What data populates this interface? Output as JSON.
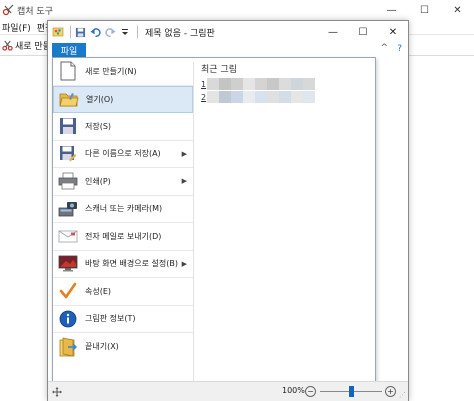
{
  "snipping_tool": {
    "title": "캡처 도구",
    "menu": [
      "파일(F)",
      "편집(E)"
    ],
    "new_button": "새로 만들기",
    "window_controls": {
      "minimize": "—",
      "maximize": "☐",
      "close": "✕"
    }
  },
  "paint": {
    "title": "제목 없음 - 그림판",
    "window_controls": {
      "minimize": "—",
      "maximize": "☐",
      "close": "✕"
    },
    "file_tab": "파일",
    "help": "?",
    "ribbon_minimize": "^",
    "qat_icons": [
      "paint-app-icon",
      "save-icon",
      "undo-icon",
      "redo-icon",
      "customize-dropdown-icon"
    ]
  },
  "file_menu": {
    "items": [
      {
        "label": "새로 만들기(N)",
        "icon": "new-file-icon",
        "submenu": false
      },
      {
        "label": "열기(O)",
        "icon": "open-folder-icon",
        "submenu": false,
        "selected": true
      },
      {
        "label": "저장(S)",
        "icon": "save-disk-icon",
        "submenu": false
      },
      {
        "label": "다른 이름으로 저장(A)",
        "icon": "save-as-icon",
        "submenu": true
      },
      {
        "label": "인쇄(P)",
        "icon": "printer-icon",
        "submenu": true
      },
      {
        "label": "스캐너 또는 카메라(M)",
        "icon": "scanner-icon",
        "submenu": false
      },
      {
        "label": "전자 메일로 보내기(D)",
        "icon": "email-icon",
        "submenu": false
      },
      {
        "label": "바탕 화면 배경으로 설정(B)",
        "icon": "desktop-background-icon",
        "submenu": true
      },
      {
        "label": "속성(E)",
        "icon": "properties-check-icon",
        "submenu": false
      },
      {
        "label": "그림판 정보(T)",
        "icon": "info-icon",
        "submenu": false
      },
      {
        "label": "끝내기(X)",
        "icon": "exit-icon",
        "submenu": false
      }
    ],
    "submenu_arrow": "▶",
    "recent_title": "최근 그림",
    "recent_items": [
      {
        "number": "1",
        "colors": [
          "#d9d9d9",
          "#c4c4c4",
          "#cfcfcf",
          "#e5e5e5",
          "#d4d4d4",
          "#c8c8c8",
          "#dcdcdc",
          "#cfd5dd",
          "#d8d8d8"
        ]
      },
      {
        "number": "2",
        "colors": [
          "#e4e4e4",
          "#bfc9d4",
          "#c9d6e6",
          "#e8ecf0",
          "#d6e2ee",
          "#e0e0e0",
          "#d3dde8",
          "#e6e6e6",
          "#dfe6ee"
        ]
      }
    ]
  },
  "status_bar": {
    "zoom": "100%",
    "zoom_minus": "−",
    "zoom_plus": "+",
    "zoom_slider_level": 0.5
  }
}
